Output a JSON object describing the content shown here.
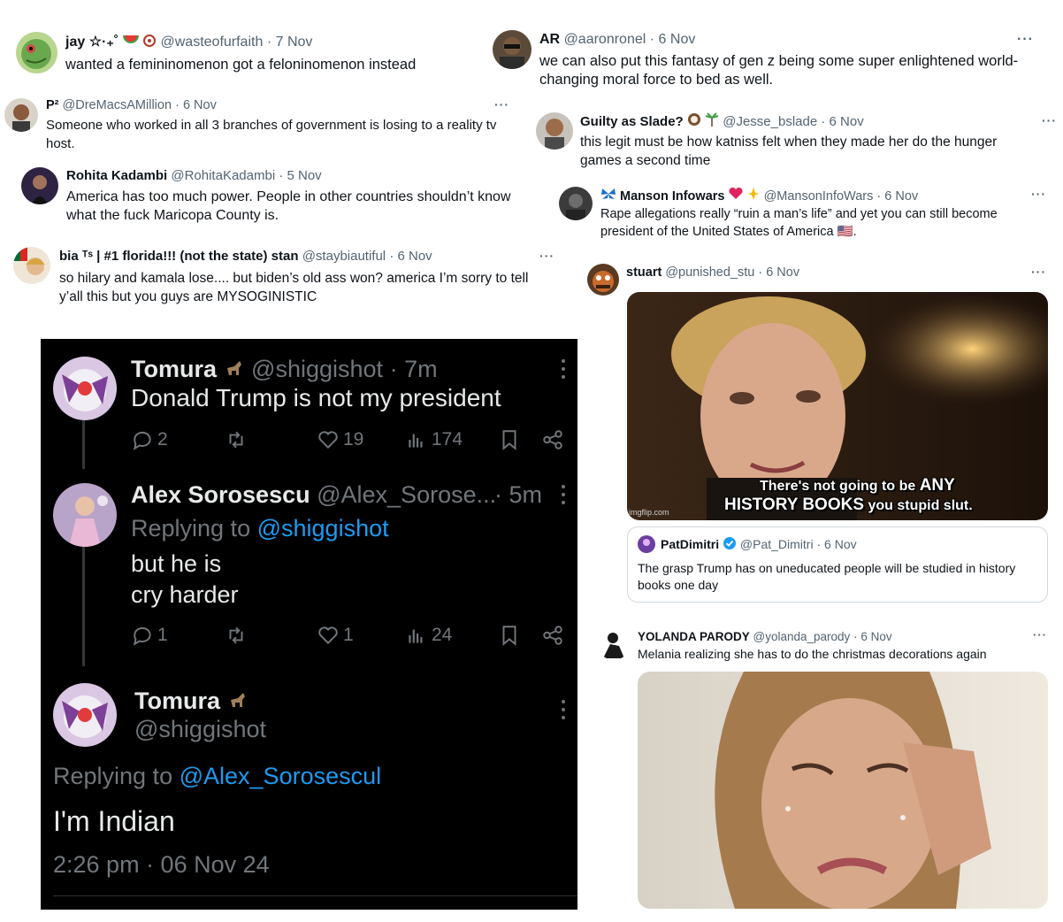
{
  "t1": {
    "name": "jay ☆·₊˚",
    "handle": "@wasteofurfaith",
    "date": "7 Nov",
    "text": "wanted a femininomenon got a feloninomenon instead"
  },
  "t2": {
    "name": "AR",
    "handle": "@aaronronel",
    "date": "6 Nov",
    "text": "we can also put this fantasy of gen z being some super enlightened world-changing moral force to bed as well."
  },
  "t3": {
    "name": "P²",
    "handle": "@DreMacsAMillion",
    "date": "6 Nov",
    "text": "Someone who worked in all 3 branches of government is losing to a reality tv host."
  },
  "t4": {
    "name": "Guilty as Slade?",
    "handle": "@Jesse_bslade",
    "date": "6 Nov",
    "text": "this legit must be how katniss felt when they made her do the hunger games a second time"
  },
  "t5": {
    "name": "Rohita Kadambi",
    "handle": "@RohitaKadambi",
    "date": "5 Nov",
    "text": "America has too much power. People in other countries shouldn’t know what the fuck Maricopa County is."
  },
  "t6": {
    "name": "Manson Infowars",
    "handle": "@MansonInfoWars",
    "date": "6 Nov",
    "text": "Rape allegations really “ruin a man’s life” and yet you can still become president of the United States of America 🇺🇸."
  },
  "t7": {
    "name": "bia ᵀˢ | #1 florida!!! (not the state) stan",
    "handle": "@staybiautiful",
    "date": "6 Nov",
    "text": "so hilary and kamala lose.... but biden’s old ass won? america I’m sorry to tell y’all this but you guys are MYSOGINISTIC"
  },
  "t8": {
    "name": "stuart",
    "handle": "@punished_stu",
    "date": "6 Nov",
    "meme_line1a": "There's not going to be",
    "meme_line1b": "ANY",
    "meme_line2a": "HISTORY BOOKS",
    "meme_line2b": "you stupid slut.",
    "meme_wm": "imgflip.com",
    "quote": {
      "name": "PatDimitri",
      "handle": "@Pat_Dimitri",
      "date": "6 Nov",
      "text": "The grasp Trump has on uneducated people will be studied in history books one day"
    }
  },
  "t9": {
    "name": "YOLANDA PARODY",
    "handle": "@yolanda_parody",
    "date": "6 Nov",
    "text": "Melania realizing she has to do the christmas decorations again"
  },
  "dark": {
    "p1": {
      "name": "Tomura",
      "handle": "@shiggishot",
      "time": "7m",
      "text": "Donald Trump is not my president",
      "replies": "2",
      "likes": "19",
      "views": "174"
    },
    "p2": {
      "name": "Alex Sorosescu",
      "handle": "@Alex_Sorose...",
      "time": "5m",
      "replying_label": "Replying to",
      "replying_to": "@shiggishot",
      "line1": "but he is",
      "line2": "cry harder",
      "replies": "1",
      "likes": "1",
      "views": "24"
    },
    "p3": {
      "name": "Tomura",
      "handle": "@shiggishot",
      "replying_label": "Replying to",
      "replying_to": "@Alex_Sorosescul",
      "text": "I'm Indian",
      "timestamp": "2:26 pm · 06 Nov 24"
    }
  },
  "more": "···",
  "sep": "·",
  "colors": {
    "link": "#1d9bf0",
    "muted": "#536471",
    "dark_bg": "#000000",
    "verified": "#1d9bf0"
  }
}
